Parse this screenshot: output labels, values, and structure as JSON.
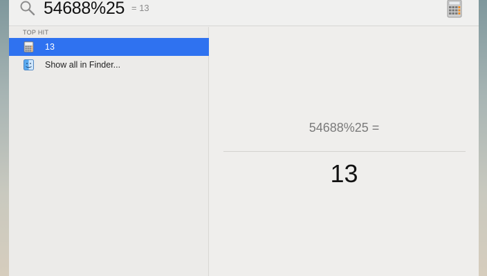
{
  "search": {
    "query": "54688%25",
    "inline_result": "= 13",
    "top_app_icon": "calculator-icon"
  },
  "results": {
    "section_header": "TOP HIT",
    "items": [
      {
        "label": "13",
        "icon": "calculator-icon",
        "selected": true
      },
      {
        "label": "Show all in Finder...",
        "icon": "finder-icon",
        "selected": false
      }
    ]
  },
  "preview": {
    "expression": "54688%25 =",
    "answer": "13"
  },
  "colors": {
    "selection": "#2f72f0",
    "calculator_orange": "#f08a1c"
  }
}
